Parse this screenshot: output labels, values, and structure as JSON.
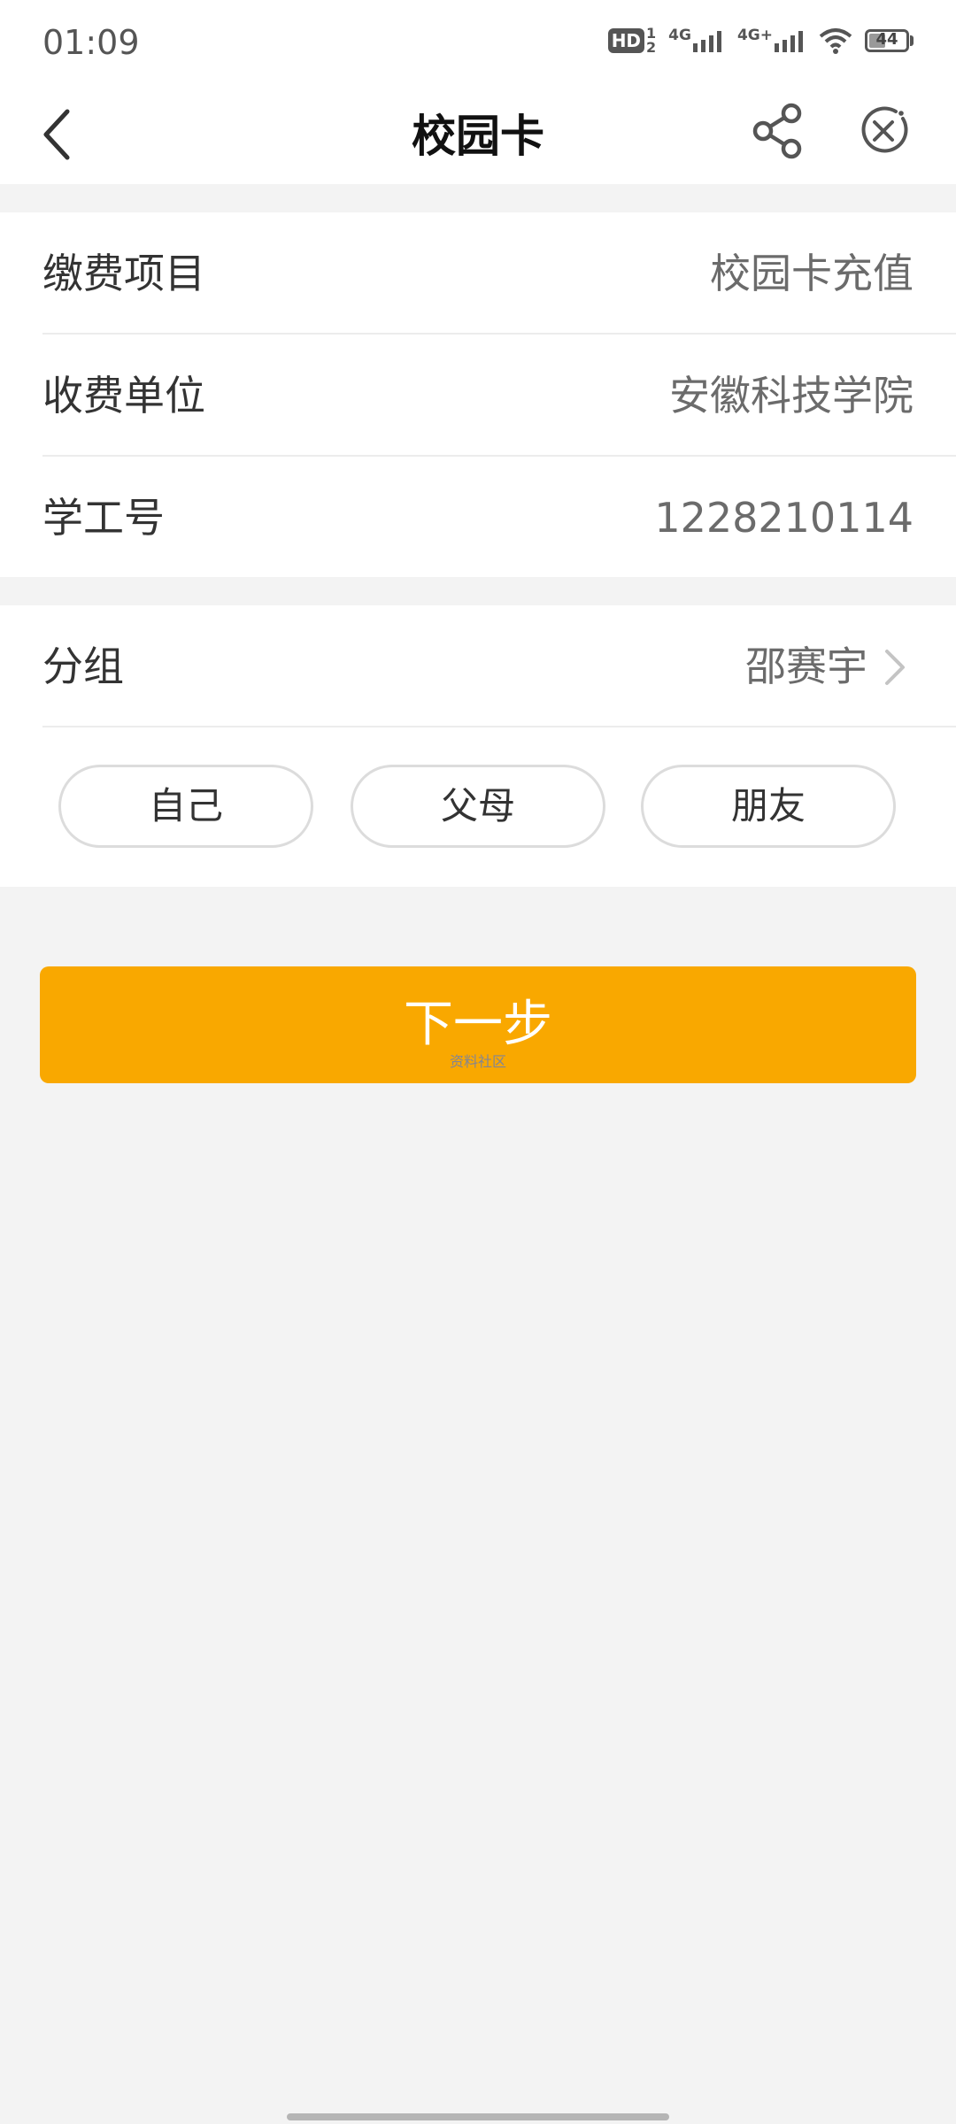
{
  "status_bar": {
    "time": "01:09",
    "hd_label": "HD",
    "hd_sub_top": "1",
    "hd_sub_bottom": "2",
    "sim1_label": "4G",
    "sim2_label": "4G+",
    "battery_level": "44"
  },
  "nav": {
    "title": "校园卡"
  },
  "info_rows": [
    {
      "label": "缴费项目",
      "value": "校园卡充值"
    },
    {
      "label": "收费单位",
      "value": "安徽科技学院"
    },
    {
      "label": "学工号",
      "value": "1228210114"
    }
  ],
  "group": {
    "label": "分组",
    "value": "邵赛宇"
  },
  "group_options": [
    "自己",
    "父母",
    "朋友"
  ],
  "next_button": {
    "label": "下一步"
  },
  "watermark": "资料社区",
  "colors": {
    "accent": "#f9a800",
    "background": "#f3f3f3",
    "card": "#ffffff"
  },
  "icons": [
    "back-arrow-icon",
    "share-icon",
    "close-circle-icon",
    "chevron-right-icon",
    "wifi-icon",
    "battery-icon",
    "signal-icon"
  ]
}
